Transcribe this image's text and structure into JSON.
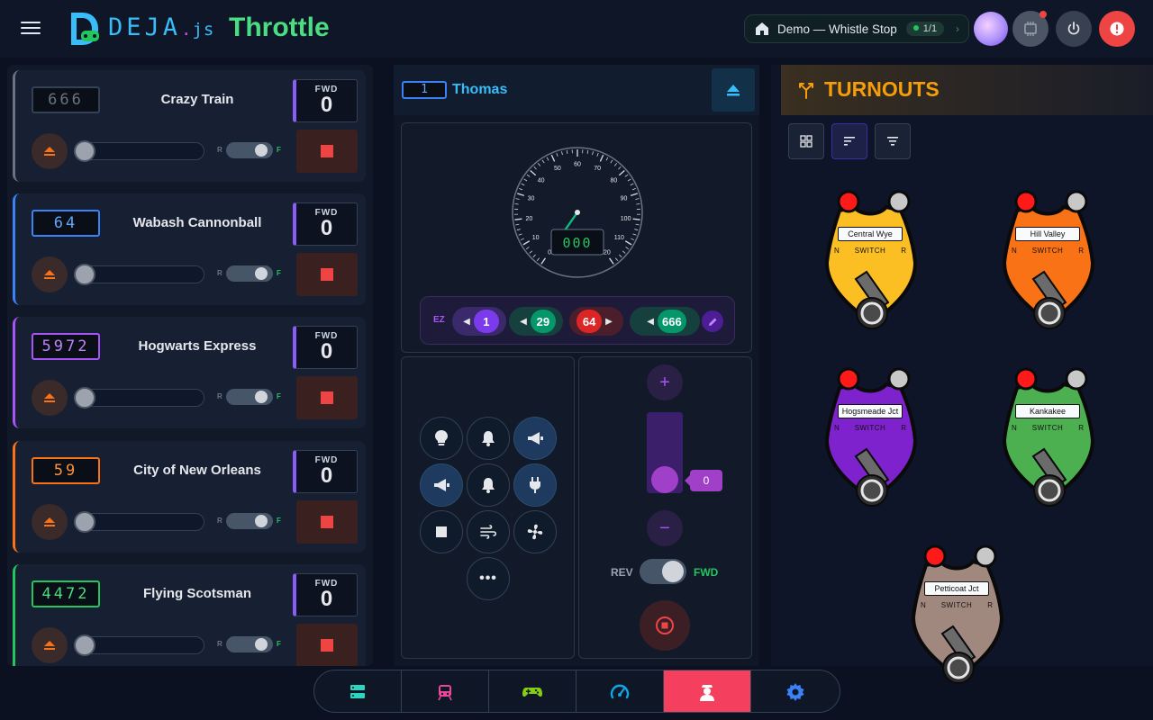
{
  "header": {
    "brand": "DEJA",
    "brand_suffix_dot": ".",
    "brand_suffix": "js",
    "title": "Throttle",
    "layout": {
      "name": "Demo — Whistle Stop",
      "count": "1/1"
    }
  },
  "roster": [
    {
      "address": "666",
      "name": "Crazy Train",
      "direction": "FWD",
      "speed": "0",
      "accent": "#6b7280",
      "addr_color": "#6b7280",
      "addr_border": "#334155"
    },
    {
      "address": "64",
      "name": "Wabash Cannonball",
      "direction": "FWD",
      "speed": "0",
      "accent": "#3b82f6",
      "addr_color": "#60a5fa",
      "addr_border": "#3b82f6"
    },
    {
      "address": "5972",
      "name": "Hogwarts Express",
      "direction": "FWD",
      "speed": "0",
      "accent": "#a855f7",
      "addr_color": "#c084fc",
      "addr_border": "#a855f7"
    },
    {
      "address": "59",
      "name": "City of New Orleans",
      "direction": "FWD",
      "speed": "0",
      "accent": "#f97316",
      "addr_color": "#fb923c",
      "addr_border": "#f97316"
    },
    {
      "address": "4472",
      "name": "Flying Scotsman",
      "direction": "FWD",
      "speed": "0",
      "accent": "#22c55e",
      "addr_color": "#4ade80",
      "addr_border": "#22c55e"
    }
  ],
  "roster_labels": {
    "rev_short": "R",
    "fwd_short": "F"
  },
  "throttle": {
    "address": "1",
    "name": "Thomas",
    "speed_readout": "000",
    "speed_value": "0",
    "gauge_ticks": [
      "0",
      "10",
      "20",
      "30",
      "40",
      "50",
      "60",
      "70",
      "80",
      "90",
      "100",
      "110",
      "120"
    ],
    "consist_label": "EZ",
    "consist": [
      {
        "address": "1",
        "color": "#7c3aed",
        "bg": "#3b2a6b",
        "arrow": "◀",
        "side": "left"
      },
      {
        "address": "29",
        "color": "#059669",
        "bg": "#15403d",
        "arrow": "◀",
        "side": "left"
      },
      {
        "address": "64",
        "color": "#dc2626",
        "bg": "#4a1f2b",
        "arrow": "▶",
        "side": "right"
      },
      {
        "address": "666",
        "color": "#059669",
        "bg": "#15403d",
        "arrow": "◀",
        "side": "left"
      }
    ],
    "rev_label": "REV",
    "fwd_label": "FWD",
    "more_label": "•••"
  },
  "turnouts": {
    "title": "TURNOUTS",
    "switch_label": "SWITCH",
    "normal_label": "N",
    "reverse_label": "R",
    "items": [
      {
        "name": "Central Wye",
        "color": "#fbbf24"
      },
      {
        "name": "Hill Valley",
        "color": "#f97316"
      },
      {
        "name": "Hogsmeade Jct",
        "color": "#7e22ce"
      },
      {
        "name": "Kankakee",
        "color": "#4caf50"
      },
      {
        "name": "Petticoat Jct",
        "color": "#a1887f"
      }
    ]
  },
  "nav": [
    {
      "icon": "server-icon",
      "color": "#2dd4bf"
    },
    {
      "icon": "train-icon",
      "color": "#ec4899"
    },
    {
      "icon": "gamepad-icon",
      "color": "#84cc16"
    },
    {
      "icon": "speedometer-icon",
      "color": "#0ea5e9"
    },
    {
      "icon": "conductor-icon",
      "color": "#ffffff",
      "active": true
    },
    {
      "icon": "gear-icon",
      "color": "#3b82f6"
    }
  ]
}
